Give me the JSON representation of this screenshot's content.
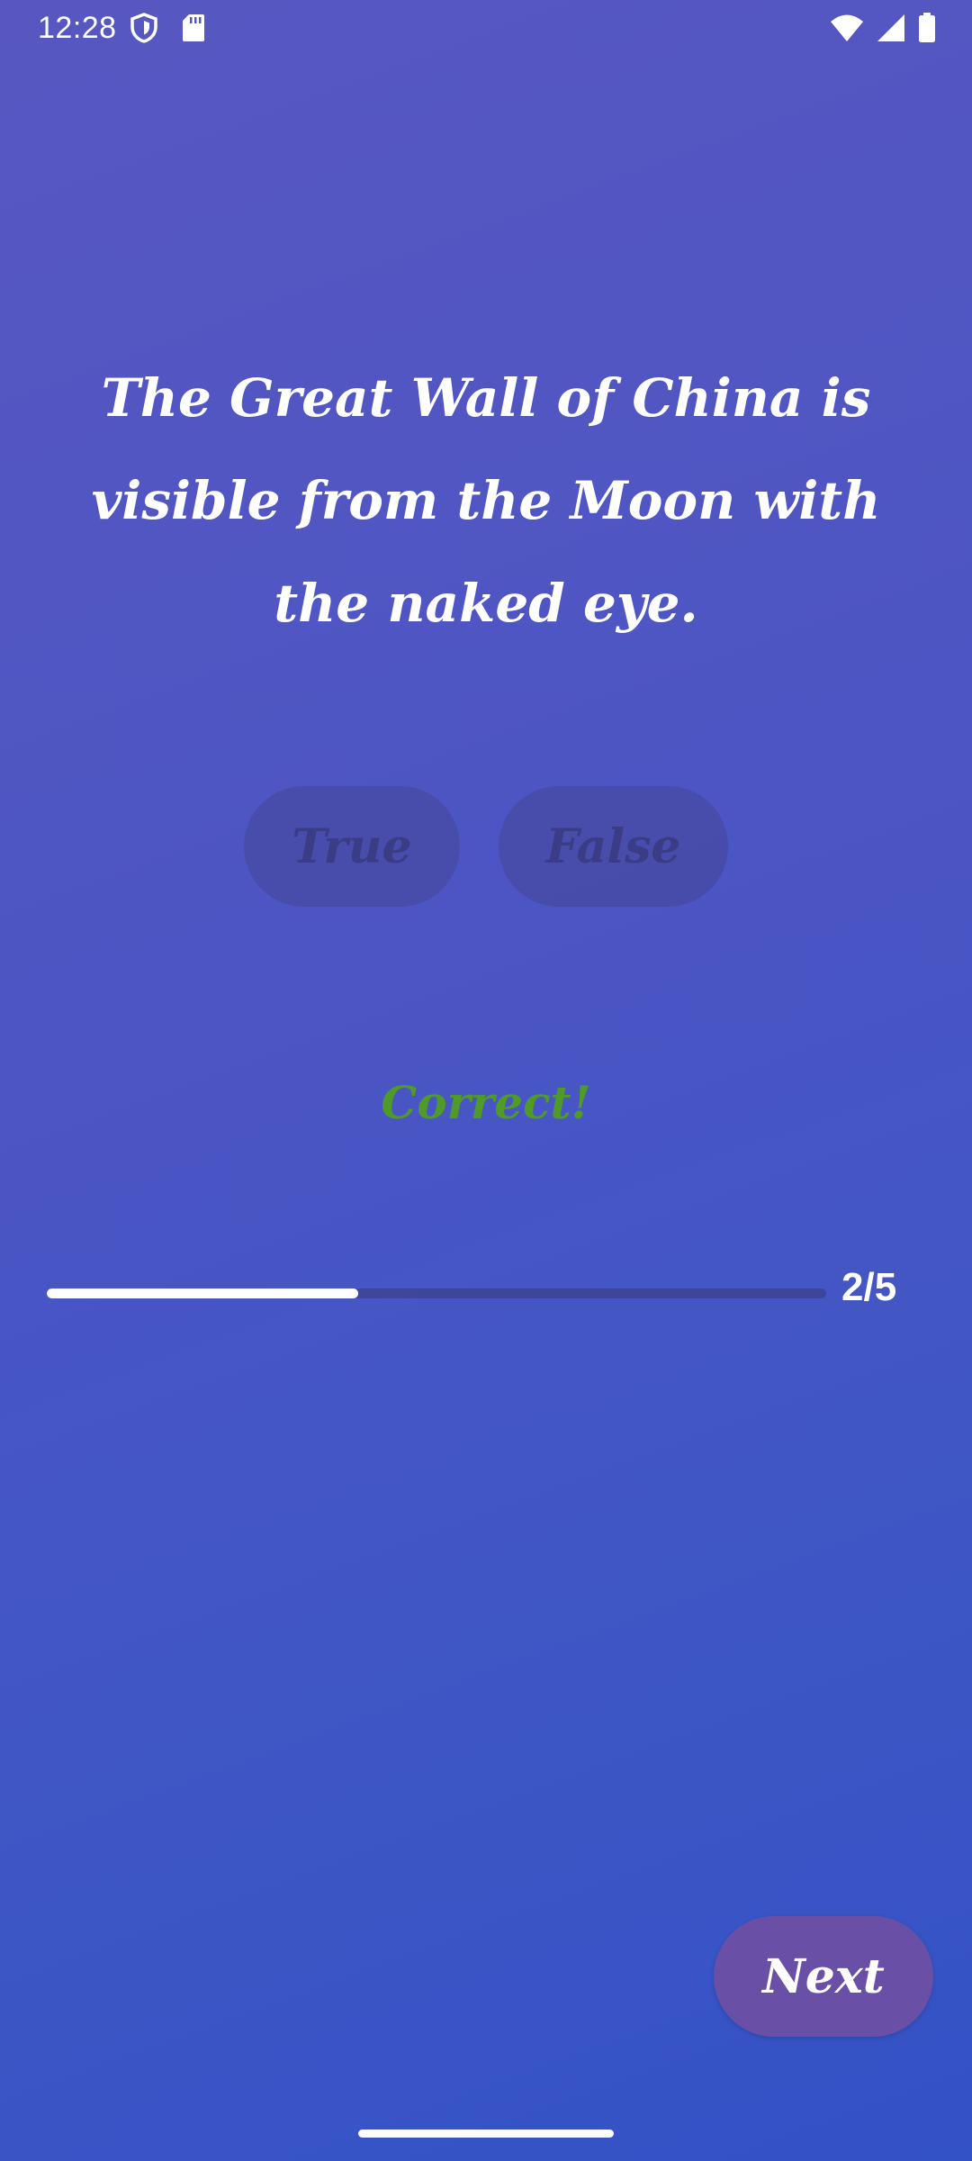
{
  "status_bar": {
    "time": "12:28",
    "left_icons": [
      "shield-icon",
      "sd-card-icon"
    ],
    "right_icons": [
      "wifi-icon",
      "signal-icon",
      "battery-icon"
    ]
  },
  "quiz": {
    "question": "The Great Wall of China is visible from the Moon with the naked eye.",
    "answers": {
      "true_label": "True",
      "false_label": "False"
    },
    "feedback": "Correct!",
    "progress": {
      "label": "2/5",
      "current": 2,
      "total": 5,
      "fraction": 0.4
    },
    "next_label": "Next"
  },
  "colors": {
    "background_start": "#5857c2",
    "background_end": "#3352c6",
    "feedback_green": "#4f9a28",
    "next_button": "#6a4fa6",
    "answer_button_text": "#3a3d86"
  }
}
